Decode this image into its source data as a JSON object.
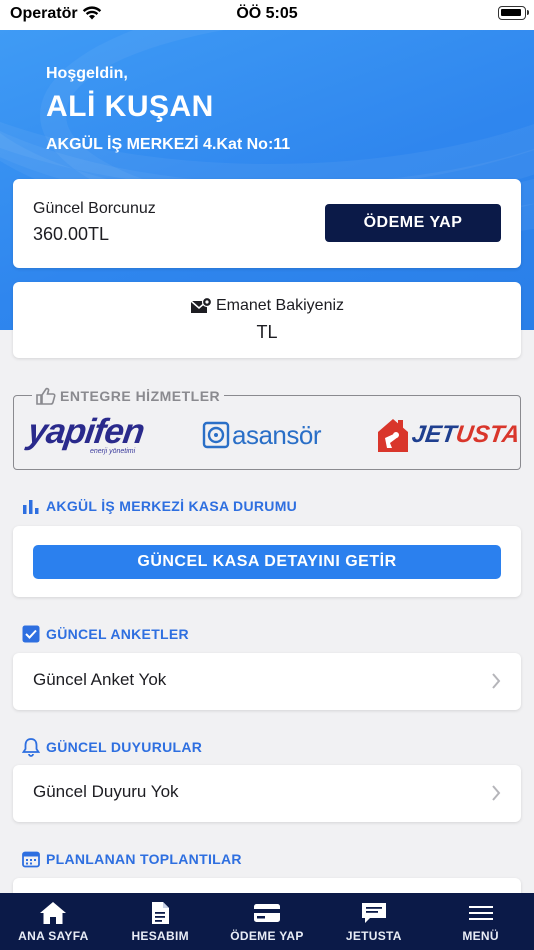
{
  "status_bar": {
    "carrier": "Operatör",
    "time": "ÖÖ 5:05"
  },
  "header": {
    "greeting": "Hoşgeldin,",
    "user_name": "ALİ KUŞAN",
    "address": "AKGÜL İŞ MERKEZİ 4.Kat No:11"
  },
  "debt": {
    "label": "Güncel Borcunuz",
    "value": "360.00TL",
    "pay_button": "ÖDEME YAP"
  },
  "escrow": {
    "label": "Emanet Bakiyeniz",
    "value": "TL"
  },
  "services": {
    "title": "ENTEGRE HİZMETLER",
    "logos": [
      {
        "name": "yapifen",
        "text": "yapifen",
        "subtext": "enerji yönetimi"
      },
      {
        "name": "asansor",
        "text": "asansör"
      },
      {
        "name": "jetusta",
        "text_a": "JET",
        "text_b": "USTA"
      }
    ]
  },
  "cash": {
    "title": "AKGÜL İŞ MERKEZİ KASA DURUMU",
    "button": "GÜNCEL KASA DETAYINI GETİR"
  },
  "surveys": {
    "title": "GÜNCEL ANKETLER",
    "item": "Güncel Anket Yok"
  },
  "announcements": {
    "title": "GÜNCEL DUYURULAR",
    "item": "Güncel Duyuru Yok"
  },
  "meetings": {
    "title": "PLANLANAN TOPLANTILAR"
  },
  "tabs": [
    {
      "label": "ANA SAYFA",
      "icon": "home-icon"
    },
    {
      "label": "HESABIM",
      "icon": "document-icon"
    },
    {
      "label": "ÖDEME YAP",
      "icon": "credit-card-icon"
    },
    {
      "label": "JETUSTA",
      "icon": "chat-icon"
    },
    {
      "label": "MENÜ",
      "icon": "menu-icon"
    }
  ],
  "colors": {
    "accent": "#2b80ee",
    "navy": "#0b1a48",
    "section_title": "#2e6fe0",
    "hero": "#3a93f2"
  }
}
